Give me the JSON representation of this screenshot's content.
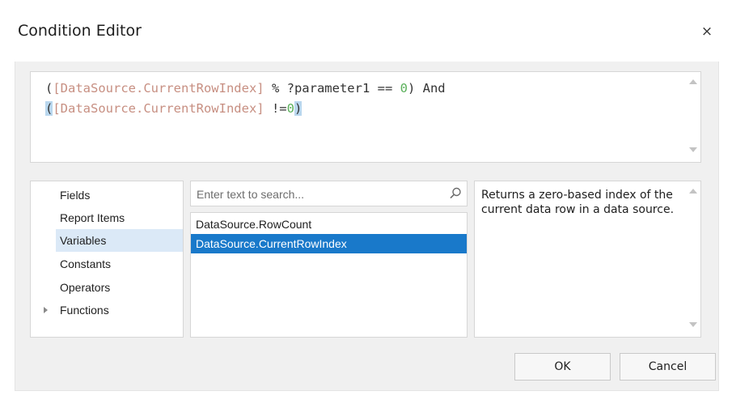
{
  "window": {
    "title": "Condition Editor",
    "close_glyph": "×"
  },
  "editor": {
    "line1": {
      "open": "(",
      "field": "[DataSource.CurrentRowIndex]",
      "middle": " % ?parameter1 == ",
      "number": "0",
      "close": ") And"
    },
    "line2": {
      "open": "(",
      "field": "[DataSource.CurrentRowIndex]",
      "middle": " !=",
      "number": "0",
      "close": ")"
    }
  },
  "categories": [
    {
      "label": "Fields",
      "selected": false
    },
    {
      "label": "Report Items",
      "selected": false
    },
    {
      "label": "Variables",
      "selected": true
    },
    {
      "label": "Constants",
      "selected": false
    },
    {
      "label": "Operators",
      "selected": false
    },
    {
      "label": "Functions",
      "selected": false,
      "expandable": true
    }
  ],
  "search": {
    "placeholder": "Enter text to search...",
    "value": ""
  },
  "items": [
    {
      "label": "DataSource.RowCount",
      "selected": false
    },
    {
      "label": "DataSource.CurrentRowIndex",
      "selected": true
    }
  ],
  "description": "Returns a zero-based index of the current data row in a data source.",
  "buttons": {
    "ok": "OK",
    "cancel": "Cancel"
  },
  "colors": {
    "selection": "#1979ca",
    "category_selection": "#dbe9f7",
    "field_token": "#c78f82",
    "number_token": "#5ab05a"
  }
}
